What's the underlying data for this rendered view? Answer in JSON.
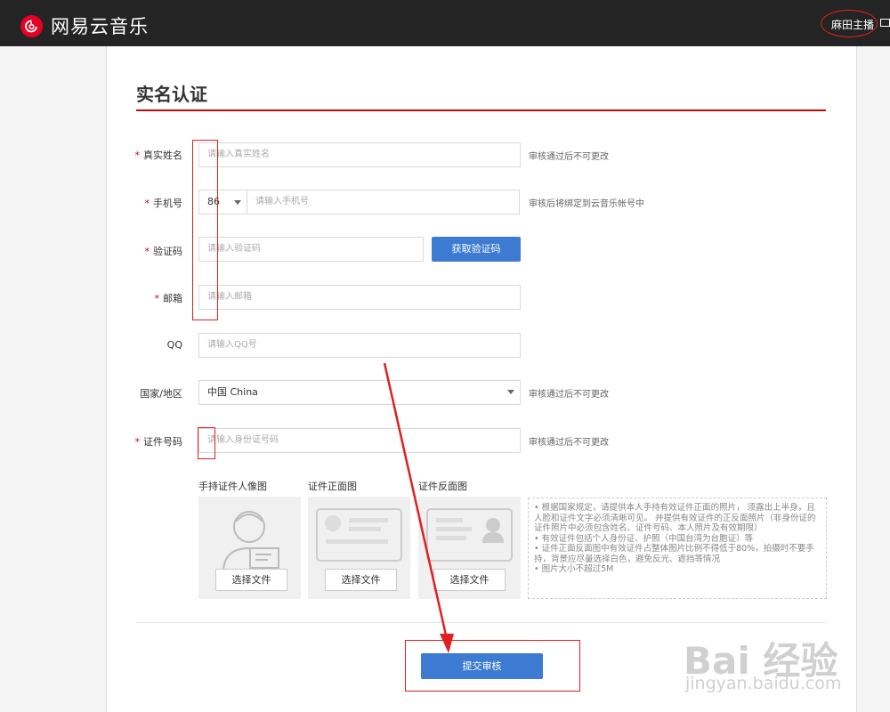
{
  "header": {
    "app_name": "网易云音乐",
    "username": "麻田主播",
    "logo_icon": "netease-cloud-music-logo-icon",
    "brand_color": "#e60026",
    "bar_color": "#242424"
  },
  "page": {
    "title": "实名认证",
    "accent_color": "#c20c0c"
  },
  "form": {
    "required_mark": "*",
    "real_name": {
      "label": "真实姓名",
      "placeholder": "请输入真实姓名",
      "hint": "审核通过后不可更改"
    },
    "phone": {
      "label": "手机号",
      "country_code": "86",
      "placeholder": "请输入手机号",
      "hint": "审核后将绑定到云音乐帐号中"
    },
    "verify_code": {
      "label": "验证码",
      "placeholder": "请输入验证码",
      "button": "获取验证码"
    },
    "email": {
      "label": "邮箱",
      "placeholder": "请输入邮箱"
    },
    "qq": {
      "label": "QQ",
      "placeholder": "请输入QQ号"
    },
    "country": {
      "label": "国家/地区",
      "value": "中国 China",
      "hint": "审核通过后不可更改"
    },
    "id_number": {
      "label": "证件号码",
      "placeholder": "请输入身份证号码",
      "hint": "审核通过后不可更改"
    }
  },
  "uploads": [
    {
      "label": "手持证件人像图",
      "button": "选择文件"
    },
    {
      "label": "证件正面图",
      "button": "选择文件"
    },
    {
      "label": "证件反面图",
      "button": "选择文件"
    }
  ],
  "notes": [
    "• 根据国家规定，请提供本人手持有效证件正面的照片， 须露出上半身，且人脸和证件文字必须清晰可见。 并提供有效证件的正反面照片（非身份证的证件照片中必须包含姓名、证件号码、本人照片及有效期限）",
    "• 有效证件包括个人身份证、护照（中国台湾为台胞证）等",
    "• 证件正面反面图中有效证件占整体图片比例不得低于80%，拍摄时不要手持，背景应尽量选择白色，避免反光、遮挡等情况",
    "• 图片大小不超过5M"
  ],
  "submit": {
    "button": "提交审核",
    "color": "#3c7bd1"
  },
  "watermark": {
    "main": "Bai 经验",
    "sub": "jingyan.baidu.com"
  }
}
